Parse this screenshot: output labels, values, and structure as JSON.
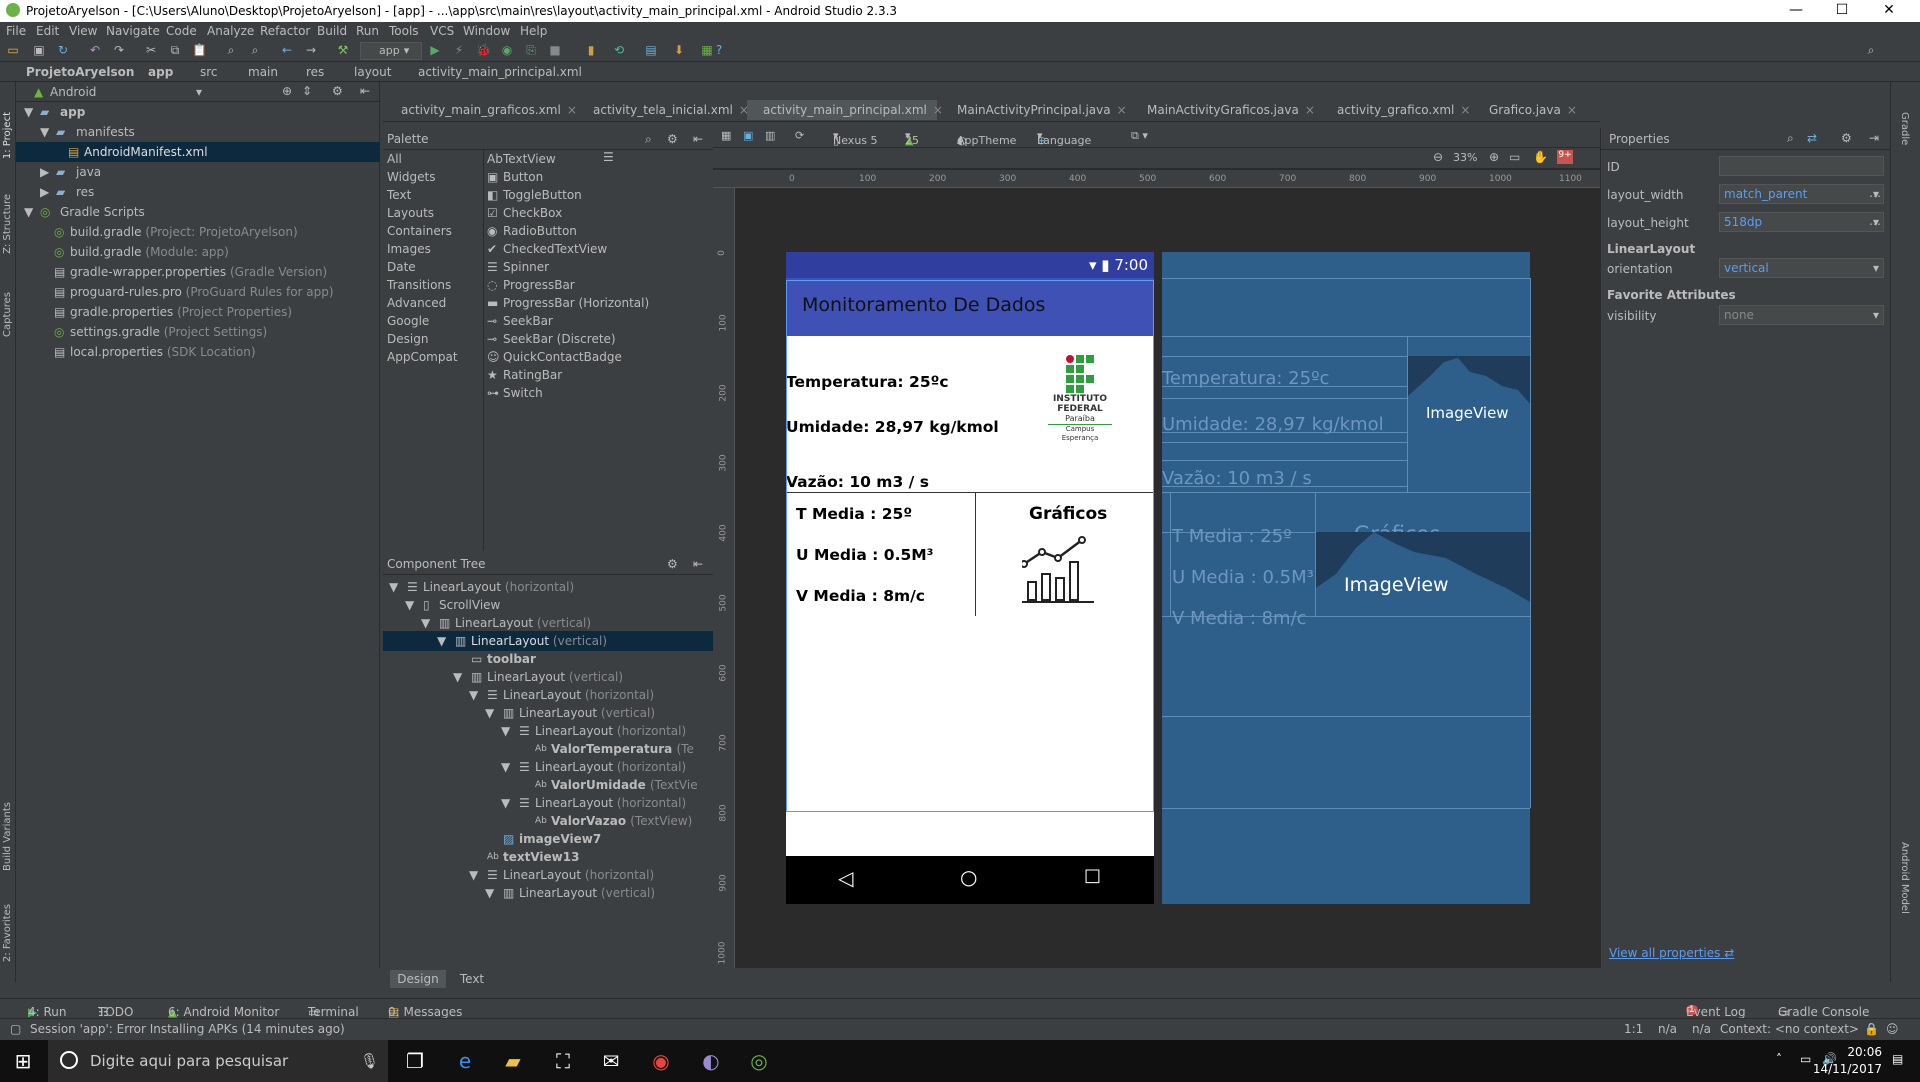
{
  "window": {
    "title": "ProjetoAryelson - [C:\\Users\\Aluno\\Desktop\\ProjetoAryelson] - [app] - ...\\app\\src\\main\\res\\layout\\activity_main_principal.xml - Android Studio 2.3.3",
    "minimize": "—",
    "maximize": "☐",
    "close": "✕"
  },
  "menu": [
    "File",
    "Edit",
    "View",
    "Navigate",
    "Code",
    "Analyze",
    "Refactor",
    "Build",
    "Run",
    "Tools",
    "VCS",
    "Window",
    "Help"
  ],
  "toolbar": {
    "run_config": "app"
  },
  "breadcrumb": [
    "ProjetoAryelson",
    "app",
    "src",
    "main",
    "res",
    "layout",
    "activity_main_principal.xml"
  ],
  "project": {
    "view": "Android",
    "rows": [
      {
        "label": "app",
        "dim": "",
        "bold": true
      },
      {
        "label": "manifests",
        "dim": ""
      },
      {
        "label": "AndroidManifest.xml",
        "dim": ""
      },
      {
        "label": "java",
        "dim": ""
      },
      {
        "label": "res",
        "dim": ""
      },
      {
        "label": "Gradle Scripts",
        "dim": ""
      },
      {
        "label": "build.gradle",
        "dim": "(Project: ProjetoAryelson)"
      },
      {
        "label": "build.gradle",
        "dim": "(Module: app)"
      },
      {
        "label": "gradle-wrapper.properties",
        "dim": "(Gradle Version)"
      },
      {
        "label": "proguard-rules.pro",
        "dim": "(ProGuard Rules for app)"
      },
      {
        "label": "gradle.properties",
        "dim": "(Project Properties)"
      },
      {
        "label": "settings.gradle",
        "dim": "(Project Settings)"
      },
      {
        "label": "local.properties",
        "dim": "(SDK Location)"
      }
    ]
  },
  "left_tabs": {
    "project": "1: Project",
    "structure": "Z: Structure",
    "captures": "Captures",
    "build_variants": "Build Variants",
    "favorites": "2: Favorites"
  },
  "editor_tabs": [
    "activity_main_graficos.xml",
    "activity_tela_inicial.xml",
    "activity_main_principal.xml",
    "MainActivityPrincipal.java",
    "MainActivityGraficos.java",
    "activity_grafico.xml",
    "Grafico.java"
  ],
  "palette": {
    "title": "Palette",
    "categories": [
      "All",
      "Widgets",
      "Text",
      "Layouts",
      "Containers",
      "Images",
      "Date",
      "Transitions",
      "Advanced",
      "Google",
      "Design",
      "AppCompat"
    ],
    "widgets": [
      "TextView",
      "Button",
      "ToggleButton",
      "CheckBox",
      "RadioButton",
      "CheckedTextView",
      "Spinner",
      "ProgressBar",
      "ProgressBar (Horizontal)",
      "SeekBar",
      "SeekBar (Discrete)",
      "QuickContactBadge",
      "RatingBar",
      "Switch"
    ]
  },
  "component_tree": {
    "title": "Component Tree",
    "rows": [
      {
        "name": "LinearLayout",
        "detail": "(horizontal)"
      },
      {
        "name": "ScrollView",
        "detail": ""
      },
      {
        "name": "LinearLayout",
        "detail": "(vertical)"
      },
      {
        "name": "LinearLayout",
        "detail": "(vertical)"
      },
      {
        "name": "toolbar",
        "detail": ""
      },
      {
        "name": "LinearLayout",
        "detail": "(vertical)"
      },
      {
        "name": "LinearLayout",
        "detail": "(horizontal)"
      },
      {
        "name": "LinearLayout",
        "detail": "(vertical)"
      },
      {
        "name": "LinearLayout",
        "detail": "(horizontal)"
      },
      {
        "name": "ValorTemperatura",
        "detail": "(Te"
      },
      {
        "name": "LinearLayout",
        "detail": "(horizontal)"
      },
      {
        "name": "ValorUmidade",
        "detail": "(TextVie"
      },
      {
        "name": "LinearLayout",
        "detail": "(horizontal)"
      },
      {
        "name": "ValorVazao",
        "detail": "(TextView)"
      },
      {
        "name": "imageView7",
        "detail": ""
      },
      {
        "name": "textView13",
        "detail": ""
      },
      {
        "name": "LinearLayout",
        "detail": "(horizontal)"
      },
      {
        "name": "LinearLayout",
        "detail": "(vertical)"
      }
    ]
  },
  "design_toolbar": {
    "device": "Nexus 5",
    "api": "25",
    "theme": "AppTheme",
    "language": "Language",
    "zoom": "33%"
  },
  "ruler_h": [
    "0",
    "100",
    "200",
    "300",
    "400",
    "500",
    "600",
    "700",
    "800",
    "900",
    "1000",
    "1100"
  ],
  "ruler_v": [
    "0",
    "100",
    "200",
    "300",
    "400",
    "500",
    "600",
    "700",
    "800",
    "900",
    "1000"
  ],
  "phone": {
    "time": "7:00",
    "app_title": "Monitoramento De Dados",
    "temperatura": "Temperatura: 25ºc",
    "umidade": "Umidade: 28,97 kg/kmol",
    "vazao": "Vazão: 10 m3 / s",
    "t_media": "T Media : 25º",
    "u_media": "U Media : 0.5M³",
    "v_media": "V Media : 8m/c",
    "graficos": "Gráficos",
    "logo": {
      "line1": "INSTITUTO",
      "line2": "FEDERAL",
      "line3": "Paraíba",
      "line4": "Campus",
      "line5": "Esperança"
    }
  },
  "blueprint": {
    "temperatura": "Temperatura: 25ºc",
    "umidade": "Umidade: 28,97 kg/kmol",
    "vazao": "Vazão: 10 m3 / s",
    "t_media": "T Media : 25º",
    "u_media": "U Media : 0.5M³",
    "v_media": "V Media : 8m/c",
    "graficos": "Gráficos",
    "imageview": "ImageView"
  },
  "properties": {
    "title": "Properties",
    "id_label": "ID",
    "id_value": "",
    "layout_width_label": "layout_width",
    "layout_width": "match_parent",
    "layout_height_label": "layout_height",
    "layout_height": "518dp",
    "section_linear": "LinearLayout",
    "orientation_label": "orientation",
    "orientation": "vertical",
    "section_fav": "Favorite Attributes",
    "visibility_label": "visibility",
    "visibility": "none",
    "view_all": "View all properties"
  },
  "right_tabs": {
    "gradle": "Gradle",
    "android_model": "Android Model"
  },
  "bottom_tabs": {
    "design": "Design",
    "text": "Text"
  },
  "tool_windows": [
    "4: Run",
    "TODO",
    "6: Android Monitor",
    "Terminal",
    "0: Messages"
  ],
  "tool_windows_right": [
    "Event Log",
    "Gradle Console"
  ],
  "event_count": "1",
  "status": {
    "message": "Session 'app': Error Installing APKs (14 minutes ago)",
    "pos": "1:1",
    "na1": "n/a",
    "na2": "n/a",
    "context": "Context: <no context>"
  },
  "taskbar": {
    "search": "Digite aqui para pesquisar",
    "time": "20:06",
    "date": "14/11/2017"
  }
}
